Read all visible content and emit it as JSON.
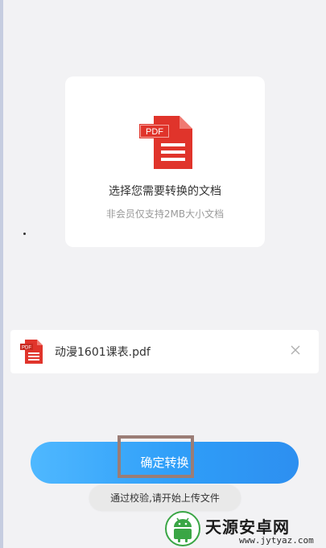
{
  "upload_card": {
    "icon": "pdf-document-icon",
    "icon_badge": "PDF",
    "title": "选择您需要转换的文档",
    "hint": "非会员仅支持2MB大小文档"
  },
  "selected_file": {
    "icon": "pdf-file-icon",
    "icon_badge": "PDF",
    "name": "动漫1601课表.pdf",
    "remove_icon": "close-icon"
  },
  "convert_button": {
    "label": "确定转换"
  },
  "toast": {
    "message": "通过校验,请开始上传文件"
  },
  "watermark": {
    "title": "天源安卓网",
    "url": "www.jytyaz.com"
  },
  "colors": {
    "pdf_red": "#e0342b",
    "button_blue": "#2f9ef8",
    "highlight_border": "#9b7d76",
    "watermark_green": "#3aa645"
  }
}
